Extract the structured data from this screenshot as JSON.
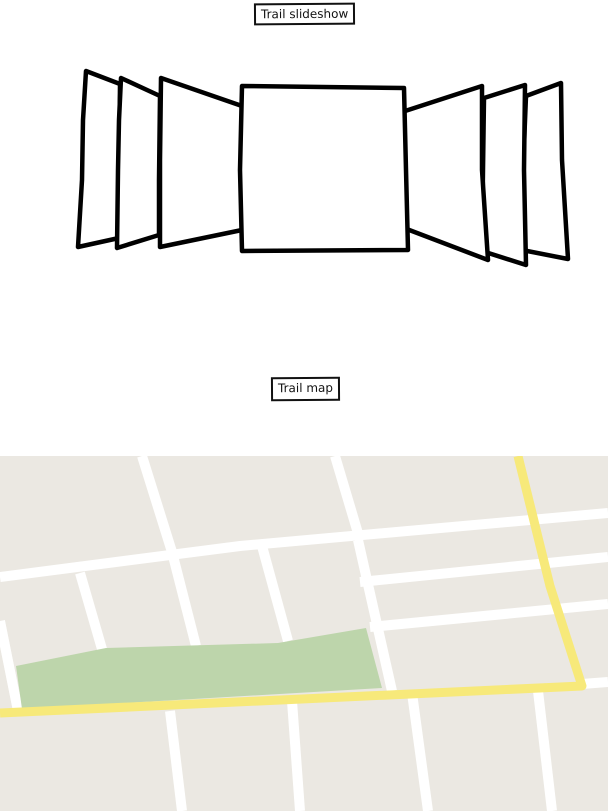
{
  "slideshow": {
    "label": "Trail slideshow",
    "slide_count": 7,
    "active_index": 3
  },
  "map": {
    "label": "Trail map",
    "colors": {
      "land": "#ebe8e2",
      "road": "#ffffff",
      "route": "#f7e97a",
      "park": "#bdd5ab"
    }
  }
}
